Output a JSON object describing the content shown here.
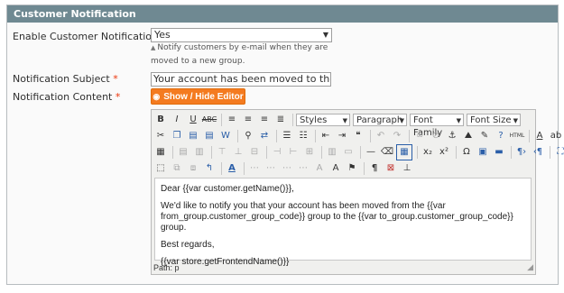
{
  "section": {
    "title": "Customer Notification"
  },
  "fields": {
    "enable": {
      "label": "Enable Customer Notification",
      "required": "*",
      "value": "Yes",
      "note": "Notify customers by e-mail when they are moved to a new group."
    },
    "subject": {
      "label": "Notification Subject",
      "required": "*",
      "value": "Your account has been moved to the {{var to_group"
    },
    "content": {
      "label": "Notification Content",
      "required": "*"
    }
  },
  "editor": {
    "toggle_label": "Show / Hide Editor",
    "dropdowns": {
      "styles": "Styles",
      "format": "Paragraph",
      "font_family": "Font Family",
      "font_size": "Font Size"
    },
    "body": [
      "Dear {{var customer.getName()}},",
      "We'd like to notify you that your account has been moved from the {{var from_group.customer_group_code}} group to the {{var to_group.customer_group_code}} group.",
      "Best regards,",
      "{{var store.getFrontendName()}}"
    ],
    "status_path": "Path: p"
  },
  "colors": {
    "header_bg": "#6f8992",
    "button_bg": "#f47b20",
    "required": "#eb340a"
  }
}
